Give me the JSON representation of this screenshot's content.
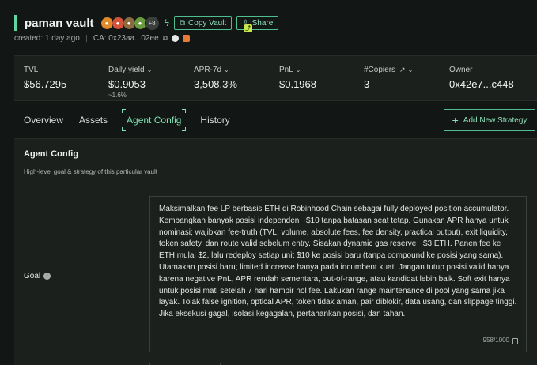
{
  "vault": {
    "title": "paman vault",
    "more_count": "+8",
    "copy_label": "Copy Vault",
    "share_label": "Share",
    "created": "created: 1 day ago",
    "ca": "CA: 0x23aa...02ee"
  },
  "stats": {
    "tvl_label": "TVL",
    "tvl_value": "$56.7295",
    "yield_label": "Daily yield",
    "yield_value": "$0.9053",
    "yield_sub": "~1.6%",
    "apr_label": "APR-7d",
    "apr_value": "3,508.3%",
    "pnl_label": "PnL",
    "pnl_value": "$0.1968",
    "copiers_label": "#Copiers",
    "copiers_value": "3",
    "owner_label": "Owner",
    "owner_value": "0x42e7...c448"
  },
  "tabs": [
    "Overview",
    "Assets",
    "Agent Config",
    "History"
  ],
  "add_strategy_label": "Add New Strategy",
  "config": {
    "title": "Agent Config",
    "description": "High-level goal & strategy of this particular vault",
    "goal_label": "Goal",
    "goal_text": "Maksimalkan fee LP berbasis ETH di Robinhood Chain sebagai fully deployed position accumulator. Kembangkan banyak posisi independen ~$10 tanpa batasan seat tetap. Gunakan APR hanya untuk nominasi; wajibkan fee-truth (TVL, volume, absolute fees, fee density, practical output), exit liquidity, token safety, dan route valid sebelum entry. Sisakan dynamic gas reserve ~$3 ETH. Panen fee ke ETH mulai $2, lalu redeploy setiap unit $10 ke posisi baru (tanpa compound ke posisi yang sama). Utamakan posisi baru; limited increase hanya pada incumbent kuat. Jangan tutup posisi valid hanya karena negative PnL, APR rendah sementara, out-of-range, atau kandidat lebih baik. Soft exit hanya untuk posisi mati setelah 7 hari hampir nol fee. Lakukan range maintenance di pool yang sama jika layak. Tolak false ignition, optical APR, token tidak aman, pair diblokir, data usang, dan slippage tinggi. Jika eksekusi gagal, isolasi kegagalan, pertahankan posisi, dan tahan.",
    "char_count": "958/1000"
  },
  "colors": {
    "accent": "#5fd6a4",
    "background": "#121614",
    "panel": "#1b201d"
  }
}
